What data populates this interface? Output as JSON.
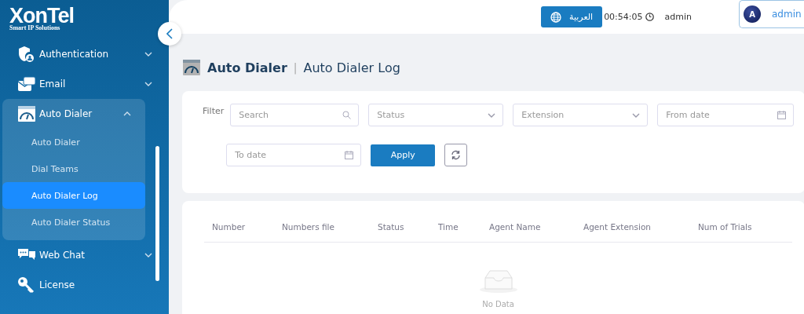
{
  "logo": {
    "name": "XonTel",
    "tagline": "Smart IP Solutions"
  },
  "sidebar": {
    "items": [
      {
        "label": "Authentication",
        "expanded": false
      },
      {
        "label": "Email",
        "expanded": false
      },
      {
        "label": "Auto Dialer",
        "expanded": true,
        "children": [
          {
            "label": "Auto Dialer",
            "selected": false
          },
          {
            "label": "Dial Teams",
            "selected": false
          },
          {
            "label": "Auto Dialer Log",
            "selected": true
          },
          {
            "label": "Auto Dialer Status",
            "selected": false
          }
        ]
      },
      {
        "label": "Web Chat",
        "expanded": false
      },
      {
        "label": "License"
      }
    ]
  },
  "header": {
    "language_button": "العربية",
    "clock": "00:54:05",
    "username": "admin",
    "user_menu": {
      "avatar": "A",
      "name": "admin"
    }
  },
  "page": {
    "section": "Auto Dialer",
    "separator": "|",
    "title": "Auto Dialer Log"
  },
  "filter": {
    "label": "Filter",
    "fields": [
      {
        "kind": "search",
        "placeholder": "Search"
      },
      {
        "kind": "select",
        "placeholder": "Status"
      },
      {
        "kind": "select",
        "placeholder": "Extension"
      },
      {
        "kind": "date",
        "placeholder": "From date"
      },
      {
        "kind": "date",
        "placeholder": "To date"
      }
    ],
    "apply_button": "Apply"
  },
  "table": {
    "columns": [
      "Number",
      "Numbers file",
      "Status",
      "Time",
      "Agent Name",
      "Agent Extension",
      "Num of Trials"
    ],
    "empty_text": "No Data"
  }
}
